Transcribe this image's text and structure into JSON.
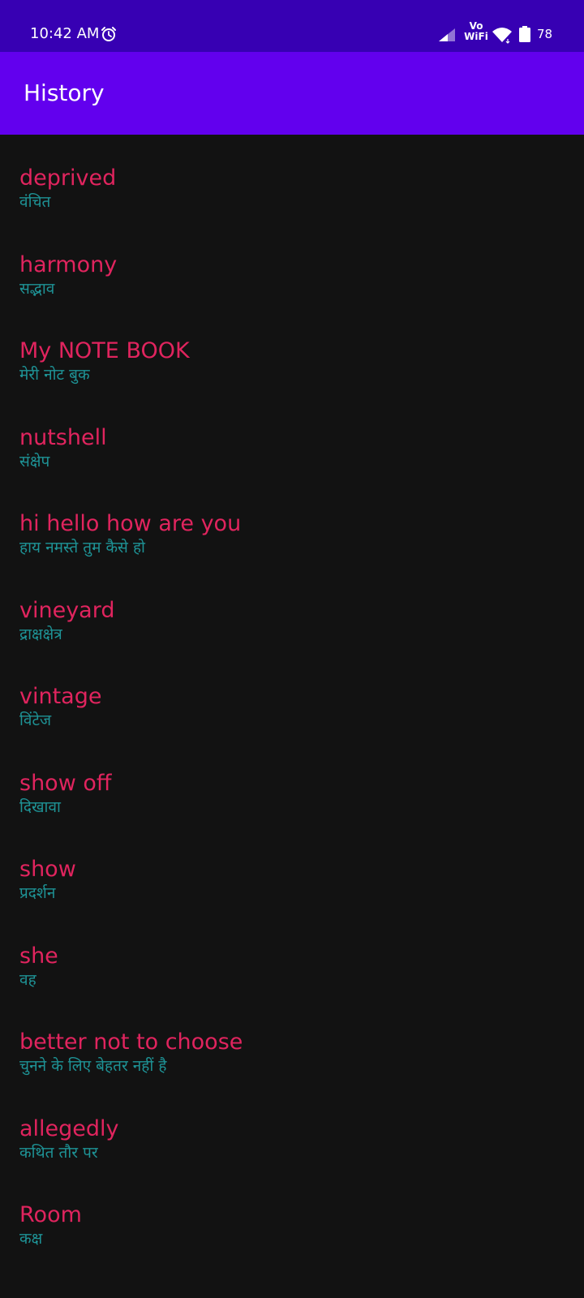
{
  "status_bar": {
    "time": "10:42 AM",
    "network_label_top": "Vo",
    "network_label_bottom": "WiFi",
    "battery_level": "78"
  },
  "app_bar": {
    "title": "History"
  },
  "history": [
    {
      "word": "deprived",
      "translation": "वंचित"
    },
    {
      "word": "harmony",
      "translation": "सद्भाव"
    },
    {
      "word": "My NOTE BOOK",
      "translation": "मेरी नोट बुक"
    },
    {
      "word": "nutshell",
      "translation": "संक्षेप"
    },
    {
      "word": "hi hello how are you",
      "translation": "हाय नमस्ते तुम कैसे हो"
    },
    {
      "word": "vineyard",
      "translation": "द्राक्षक्षेत्र"
    },
    {
      "word": "vintage",
      "translation": "विंटेज"
    },
    {
      "word": "show off",
      "translation": "दिखावा"
    },
    {
      "word": "show",
      "translation": "प्रदर्शन"
    },
    {
      "word": "she",
      "translation": "वह"
    },
    {
      "word": "better not to choose",
      "translation": "चुनने के लिए बेहतर नहीं है"
    },
    {
      "word": "allegedly",
      "translation": "कथित तौर पर"
    },
    {
      "word": "Room",
      "translation": "कक्ष"
    }
  ],
  "colors": {
    "status_bar": "#3700B3",
    "app_bar": "#6200EE",
    "background": "#121212",
    "word": "#E0245E",
    "translation": "#1E9396"
  }
}
